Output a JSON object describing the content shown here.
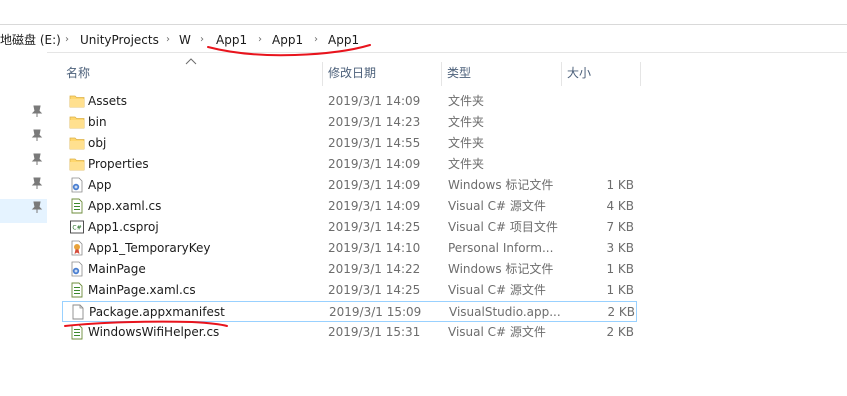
{
  "address": {
    "crumbs": [
      "地磁盘 (E:)",
      "UnityProjects",
      "W",
      "App1",
      "App1",
      "App1"
    ],
    "separator": "›"
  },
  "columns": {
    "name": "名称",
    "date": "修改日期",
    "type": "类型",
    "size": "大小"
  },
  "files": [
    {
      "name": "Assets",
      "date": "2019/3/1 14:09",
      "type": "文件夹",
      "size": "",
      "icon": "folder-icon"
    },
    {
      "name": "bin",
      "date": "2019/3/1 14:23",
      "type": "文件夹",
      "size": "",
      "icon": "folder-icon"
    },
    {
      "name": "obj",
      "date": "2019/3/1 14:55",
      "type": "文件夹",
      "size": "",
      "icon": "folder-icon"
    },
    {
      "name": "Properties",
      "date": "2019/3/1 14:09",
      "type": "文件夹",
      "size": "",
      "icon": "folder-icon"
    },
    {
      "name": "App",
      "date": "2019/3/1 14:09",
      "type": "Windows 标记文件",
      "size": "1 KB",
      "icon": "xaml-file-icon"
    },
    {
      "name": "App.xaml.cs",
      "date": "2019/3/1 14:09",
      "type": "Visual C# 源文件",
      "size": "4 KB",
      "icon": "csharp-source-icon"
    },
    {
      "name": "App1.csproj",
      "date": "2019/3/1 14:25",
      "type": "Visual C# 项目文件",
      "size": "7 KB",
      "icon": "csproj-file-icon"
    },
    {
      "name": "App1_TemporaryKey",
      "date": "2019/3/1 14:10",
      "type": "Personal Inform...",
      "size": "3 KB",
      "icon": "certificate-key-icon"
    },
    {
      "name": "MainPage",
      "date": "2019/3/1 14:22",
      "type": "Windows 标记文件",
      "size": "1 KB",
      "icon": "xaml-file-icon"
    },
    {
      "name": "MainPage.xaml.cs",
      "date": "2019/3/1 14:25",
      "type": "Visual C# 源文件",
      "size": "1 KB",
      "icon": "csharp-source-icon"
    },
    {
      "name": "Package.appxmanifest",
      "date": "2019/3/1 15:09",
      "type": "VisualStudio.app...",
      "size": "2 KB",
      "icon": "blank-document-icon"
    },
    {
      "name": "WindowsWifiHelper.cs",
      "date": "2019/3/1 15:31",
      "type": "Visual C# 源文件",
      "size": "2 KB",
      "icon": "csharp-source-icon"
    }
  ],
  "selected_file_index": 10,
  "colors": {
    "folder": "#ffd76e",
    "selection_border": "#99d1ff",
    "nav_selection": "#e5f3ff",
    "annotation_red": "#e8141d",
    "header_text": "#4c607a"
  }
}
